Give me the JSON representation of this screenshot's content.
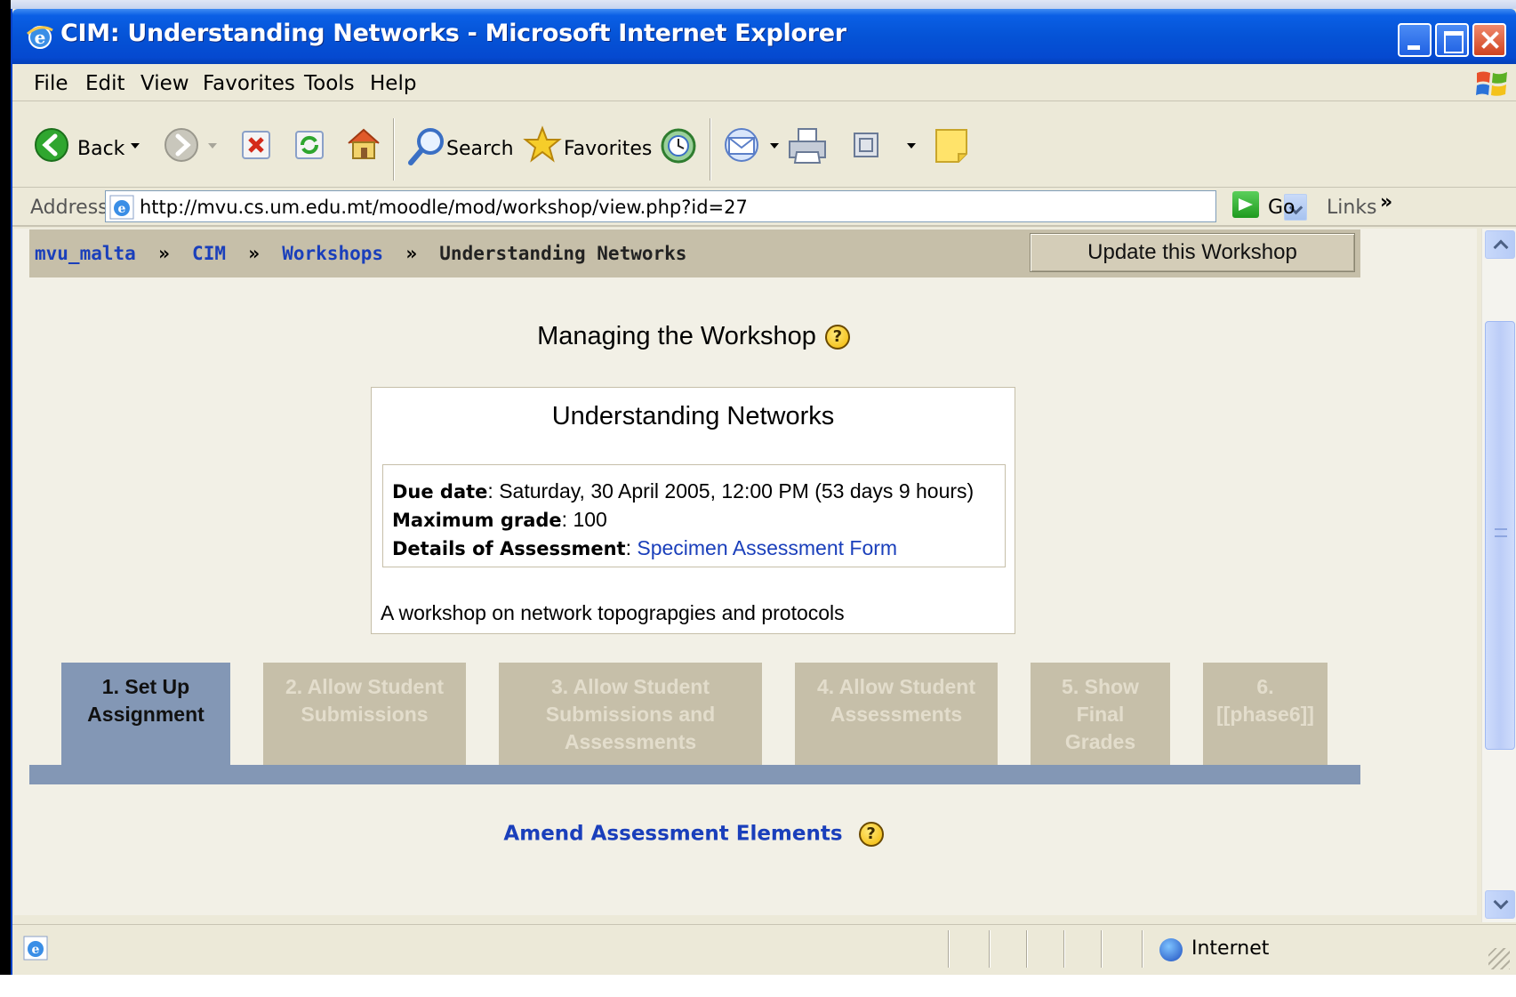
{
  "window": {
    "title": "CIM: Understanding Networks - Microsoft Internet Explorer"
  },
  "menu": [
    "File",
    "Edit",
    "View",
    "Favorites",
    "Tools",
    "Help"
  ],
  "toolbar": {
    "back_label": "Back",
    "search_label": "Search",
    "favorites_label": "Favorites"
  },
  "address": {
    "label": "Address",
    "url": "http://mvu.cs.um.edu.mt/moodle/mod/workshop/view.php?id=27",
    "go_label": "Go",
    "links_label": "Links",
    "links_chevron": "»"
  },
  "breadcrumb": {
    "items": [
      "mvu_malta",
      "CIM",
      "Workshops"
    ],
    "separator": "»",
    "current": "Understanding Networks"
  },
  "update_button": "Update this Workshop",
  "page": {
    "heading": "Managing the Workshop",
    "help_glyph": "?"
  },
  "workshop": {
    "title": "Understanding Networks",
    "due_label": "Due date",
    "due_value": ": Saturday, 30 April 2005, 12:00 PM (53 days 9 hours)",
    "grade_label": "Maximum grade",
    "grade_value": ": 100",
    "assessment_label": "Details of Assessment",
    "assessment_sep": ": ",
    "assessment_link": "Specimen Assessment Form",
    "description": "A workshop on network topograpgies and protocols"
  },
  "phases": [
    {
      "line1": "1. Set Up",
      "line2": "Assignment",
      "line3": "",
      "active": true
    },
    {
      "line1": "2. Allow Student",
      "line2": "Submissions",
      "line3": "",
      "active": false
    },
    {
      "line1": "3. Allow Student",
      "line2": "Submissions and",
      "line3": "Assessments",
      "active": false
    },
    {
      "line1": "4. Allow Student",
      "line2": "Assessments",
      "line3": "",
      "active": false
    },
    {
      "line1": "5. Show",
      "line2": "Final",
      "line3": "Grades",
      "active": false
    },
    {
      "line1": "6.",
      "line2": "[[phase6]]",
      "line3": "",
      "active": false
    }
  ],
  "amend_link": "Amend Assessment Elements",
  "status": {
    "zone": "Internet"
  },
  "colors": {
    "title_bar": "#0553d6",
    "nav_bar": "#c6bfa9",
    "active_tab": "#8397b5",
    "link": "#1a3fbb"
  },
  "icons": [
    "ie-logo-icon",
    "windows-logo-icon",
    "back-icon",
    "forward-icon",
    "stop-icon",
    "refresh-icon",
    "home-icon",
    "search-icon",
    "favorites-star-icon",
    "history-icon",
    "mail-icon",
    "print-icon",
    "edit-icon",
    "note-icon",
    "go-arrow-icon",
    "help-icon",
    "globe-icon"
  ]
}
